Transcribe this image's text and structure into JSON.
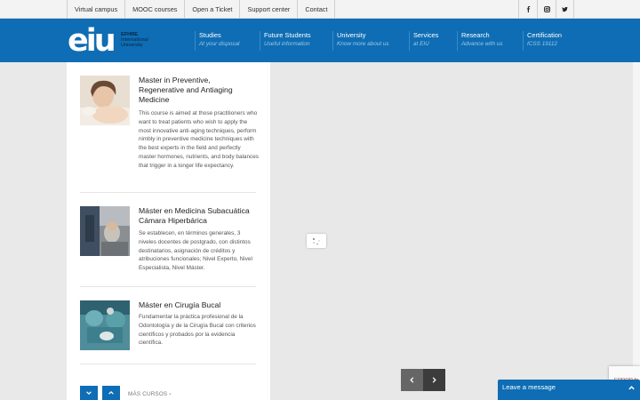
{
  "topbar": {
    "links": [
      "Virtual campus",
      "MOOC courses",
      "Open a Ticket",
      "Support center",
      "Contact"
    ],
    "social": [
      {
        "icon": "facebook-icon",
        "glyph": "f"
      },
      {
        "icon": "instagram-icon",
        "glyph": "ig"
      },
      {
        "icon": "twitter-icon",
        "glyph": "t"
      }
    ]
  },
  "header": {
    "logo": {
      "mark": "eiu",
      "line1": "EFHRE",
      "line2": "International",
      "line3": "University"
    },
    "nav": [
      {
        "title": "Studies",
        "subtitle": "At your disposal"
      },
      {
        "title": "Future Students",
        "subtitle": "Useful information"
      },
      {
        "title": "University",
        "subtitle": "Know more about us"
      },
      {
        "title": "Services",
        "subtitle": "at EIU"
      },
      {
        "title": "Research",
        "subtitle": "Advance with us"
      },
      {
        "title": "Certification",
        "subtitle": "ICSS 19112"
      }
    ],
    "accent": "#0e6db4"
  },
  "courses": [
    {
      "title": "Master in Preventive, Regenerative and Antiaging Medicine",
      "description": "This course is aimed at those practitioners who want to treat patients who wish to apply the most innovative anti-aging techniques, perform nimbly in preventive medicine techniques with the best experts in the field and perfectly master hormones, nutrients, and body balances that trigger in a longer life expectancy."
    },
    {
      "title": "Máster en Medicina Subacuática Cámara Hiperbárica",
      "description": "Se establecen, en términos generales, 3 niveles docentes de postgrado, con distintos destinatarios, asignación de créditos y atribuciones funcionales; Nivel Experto, Nivel Especialista, Nivel Máster."
    },
    {
      "title": "Máster en Cirugía Bucal",
      "description": "Fundamentar la práctica profesional de la Odontología y de la Cirugía Bucal con criterios científicos y probados por la evidencia científica."
    }
  ],
  "list_controls": {
    "more_label": "MÁS CURSOS ›"
  },
  "slider": {
    "prev": "‹",
    "next": "›"
  },
  "recaptcha": {
    "text": "ERROR fo"
  },
  "chat": {
    "label": "Leave a message"
  }
}
